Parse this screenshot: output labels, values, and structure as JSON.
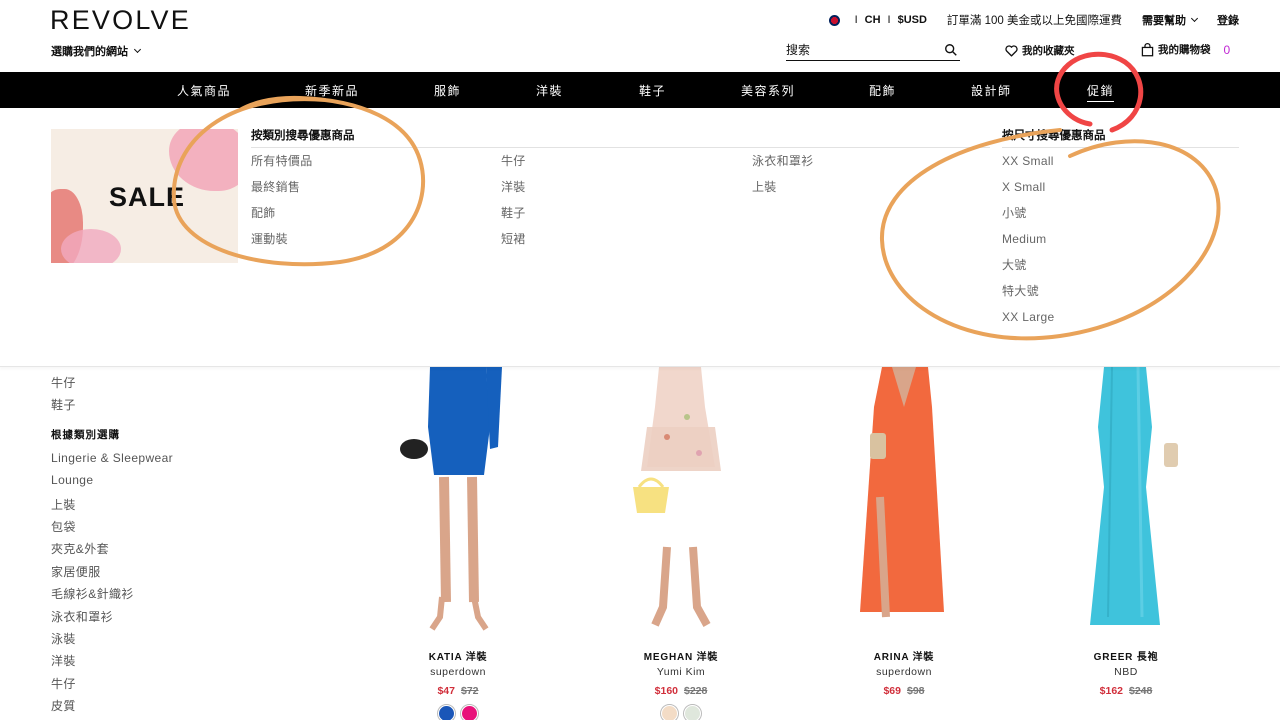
{
  "header": {
    "logo": "REVOLVE",
    "site_select": "選購我們的網站",
    "lang": "CH",
    "currency": "$USD",
    "shipping": "訂單滿 100 美金或以上免國際運費",
    "help": "需要幫助",
    "login": "登錄",
    "search_placeholder": "搜索",
    "wishlist": "我的收藏夾",
    "bag": "我的購物袋",
    "bag_count": "0"
  },
  "nav": {
    "items": [
      "人氣商品",
      "新季新品",
      "服飾",
      "洋裝",
      "鞋子",
      "美容系列",
      "配飾",
      "設計師",
      "促銷"
    ],
    "active": "促銷"
  },
  "mega": {
    "banner_text": "SALE",
    "category_heading": "按類別搜尋優惠商品",
    "col1": [
      "所有特價品",
      "最終銷售",
      "配飾",
      "運動裝"
    ],
    "col2": [
      "牛仔",
      "洋裝",
      "鞋子",
      "短裙"
    ],
    "col3": [
      "泳衣和罩衫",
      "上裝"
    ],
    "size_heading": "按尺寸搜尋優惠商品",
    "sizes": [
      "XX Small",
      "X Small",
      "小號",
      "Medium",
      "大號",
      "特大號",
      "XX Large"
    ]
  },
  "sidebar": {
    "top_items": [
      "牛仔",
      "鞋子"
    ],
    "category_heading": "根據類別選購",
    "items": [
      "Lingerie & Sleepwear",
      "Lounge",
      "上裝",
      "包袋",
      "夾克&外套",
      "家居便服",
      "毛線衫&針織衫",
      "泳衣和罩衫",
      "泳裝",
      "洋裝",
      "牛仔",
      "皮質"
    ]
  },
  "products": [
    {
      "name": "KATIA 洋裝",
      "brand": "superdown",
      "price": "$47",
      "orig_price": "$72",
      "swatches": [
        "#1a56b8",
        "#e8127a"
      ],
      "dress_color": "#1560bd"
    },
    {
      "name": "MEGHAN 洋裝",
      "brand": "Yumi Kim",
      "price": "$160",
      "orig_price": "$228",
      "swatches": [
        "#f3dcc6",
        "#dfe7dc"
      ],
      "dress_color": "#f1d7cc"
    },
    {
      "name": "ARINA 洋裝",
      "brand": "superdown",
      "price": "$69",
      "orig_price": "$98",
      "swatches": [],
      "dress_color": "#f2693e"
    },
    {
      "name": "GREER 長袍",
      "brand": "NBD",
      "price": "$162",
      "orig_price": "$248",
      "swatches": [],
      "dress_color": "#3fc3dc"
    }
  ],
  "colors": {
    "accent_sale": "#d12f3b",
    "annotation_orange": "#e9a35a",
    "annotation_red": "#f04545",
    "bag_count": "#c026d3"
  }
}
